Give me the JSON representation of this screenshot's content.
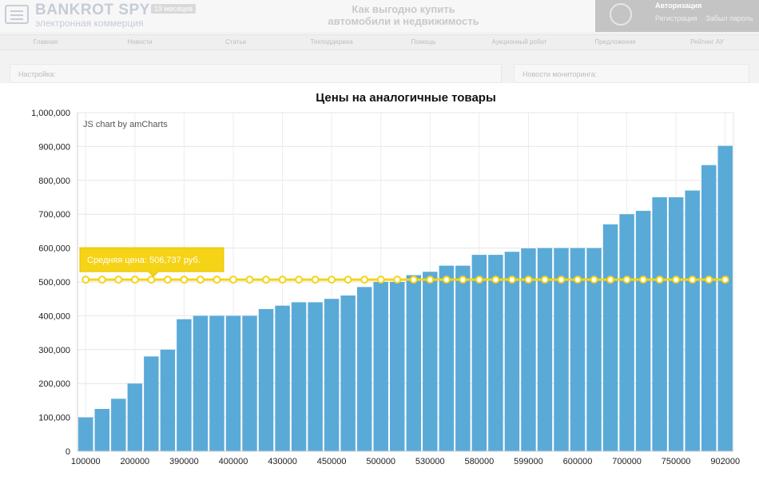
{
  "site": {
    "logo_title": "BANKROT SPY",
    "logo_subtitle": "электронная коммерция",
    "beta_badge": "19 месяцев",
    "slogan_line1": "Как выгодно купить",
    "slogan_line2": "автомобили и недвижимость",
    "auth_title": "Авторизация",
    "auth_register": "Регистрация",
    "auth_forgot": "Забыл пароль",
    "nav": [
      "Главная",
      "Новости",
      "Статьи",
      "Техподдержка",
      "Помощь",
      "Аукционный робот",
      "Предложения",
      "Рейтинг АУ"
    ],
    "panel_left": "Настройка:",
    "panel_right": "Новости мониторинга:"
  },
  "chart_data": {
    "type": "bar",
    "title": "Цены на аналогичные товары",
    "credit": "JS chart by amCharts",
    "ylim": [
      0,
      1000000
    ],
    "yticks": [
      "0",
      "100,000",
      "200,000",
      "300,000",
      "400,000",
      "500,000",
      "600,000",
      "700,000",
      "800,000",
      "900,000",
      "1,000,000"
    ],
    "xtick_labels": [
      "100000",
      "200000",
      "390000",
      "400000",
      "430000",
      "450000",
      "500000",
      "530000",
      "580000",
      "599000",
      "600000",
      "700000",
      "750000",
      "902000"
    ],
    "values": [
      100000,
      125000,
      155000,
      200000,
      280000,
      300000,
      390000,
      400000,
      400000,
      400000,
      400000,
      420000,
      430000,
      440000,
      440000,
      450000,
      460000,
      485000,
      500000,
      500000,
      520000,
      530000,
      548000,
      548000,
      580000,
      580000,
      589000,
      599000,
      600000,
      600000,
      600000,
      600000,
      670000,
      700000,
      710000,
      750000,
      750000,
      770000,
      845000,
      902000
    ],
    "average": {
      "value": 506737,
      "label": "Средняя цена: 506,737 руб."
    },
    "grid": true,
    "colors": {
      "bar": "#5aaad8",
      "average": "#f5d316",
      "tooltip": "#f5d316"
    }
  }
}
